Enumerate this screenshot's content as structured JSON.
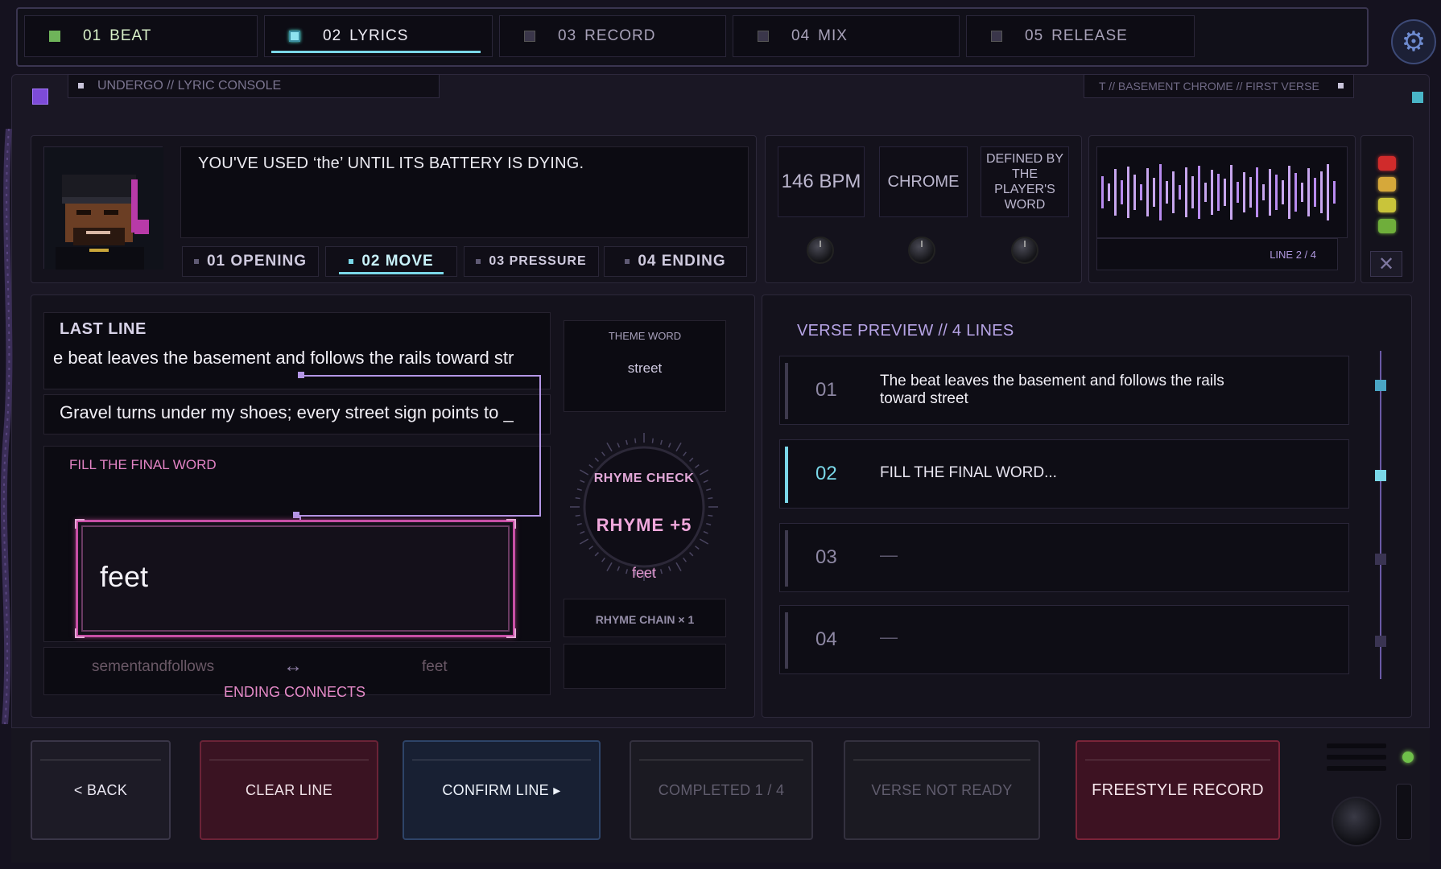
{
  "tabs": [
    {
      "num": "01",
      "label": "BEAT",
      "state": "done"
    },
    {
      "num": "02",
      "label": "LYRICS",
      "state": "active"
    },
    {
      "num": "03",
      "label": "RECORD",
      "state": "locked"
    },
    {
      "num": "04",
      "label": "MIX",
      "state": "locked"
    },
    {
      "num": "05",
      "label": "RELEASE",
      "state": "locked"
    }
  ],
  "header": {
    "left": "UNDERGO // LYRIC CONSOLE",
    "right": "T // BASEMENT CHROME  //  FIRST VERSE"
  },
  "prompt": "YOU'VE USED ‘the’ UNTIL ITS BATTERY IS DYING.",
  "sections": [
    {
      "num": "01",
      "label": "OPENING"
    },
    {
      "num": "02",
      "label": "MOVE"
    },
    {
      "num": "03",
      "label": "PRESSURE"
    },
    {
      "num": "04",
      "label": "ENDING"
    }
  ],
  "stats": {
    "bpm": "146 BPM",
    "style": "CHROME",
    "defined": "DEFINED BY THE PLAYER'S WORD"
  },
  "line_indicator": "LINE 2 / 4",
  "lights": [
    "#d02b2b",
    "#d6a83a",
    "#c9c43a",
    "#6fae3b"
  ],
  "last_line": {
    "label": "LAST LINE",
    "text": "e beat leaves the basement and follows the rails toward str"
  },
  "current_line": "Gravel turns under my shoes; every street sign points to _",
  "fill": {
    "label": "FILL THE FINAL WORD",
    "answer": "feet"
  },
  "ending": {
    "a": "sementandfollows",
    "arrow": "↔",
    "b": "feet",
    "label": "ENDING CONNECTS"
  },
  "theme": {
    "label": "THEME WORD",
    "word": "street"
  },
  "rhyme": {
    "check": "RHYME CHECK",
    "value": "RHYME  +5",
    "word": "feet",
    "chain": "RHYME CHAIN  × 1"
  },
  "verse": {
    "title": "VERSE PREVIEW // 4 LINES",
    "lines": [
      {
        "num": "01",
        "text": "The beat leaves the basement and follows the rails toward street"
      },
      {
        "num": "02",
        "text": "FILL THE FINAL WORD..."
      },
      {
        "num": "03",
        "text": "—"
      },
      {
        "num": "04",
        "text": "—"
      }
    ]
  },
  "buttons": {
    "back": "<  BACK",
    "clear": "CLEAR LINE",
    "confirm": "CONFIRM LINE  ▸",
    "completed": "COMPLETED 1 / 4",
    "not_ready": "VERSE NOT READY",
    "freestyle": "FREESTYLE RECORD"
  },
  "colors": {
    "accent_cyan": "#7ad7e8",
    "accent_pink": "#c84fa6",
    "accent_purple": "#b496e6",
    "danger": "#6b2337"
  },
  "icons": [
    "gear-icon",
    "avatar",
    "close-icon"
  ]
}
